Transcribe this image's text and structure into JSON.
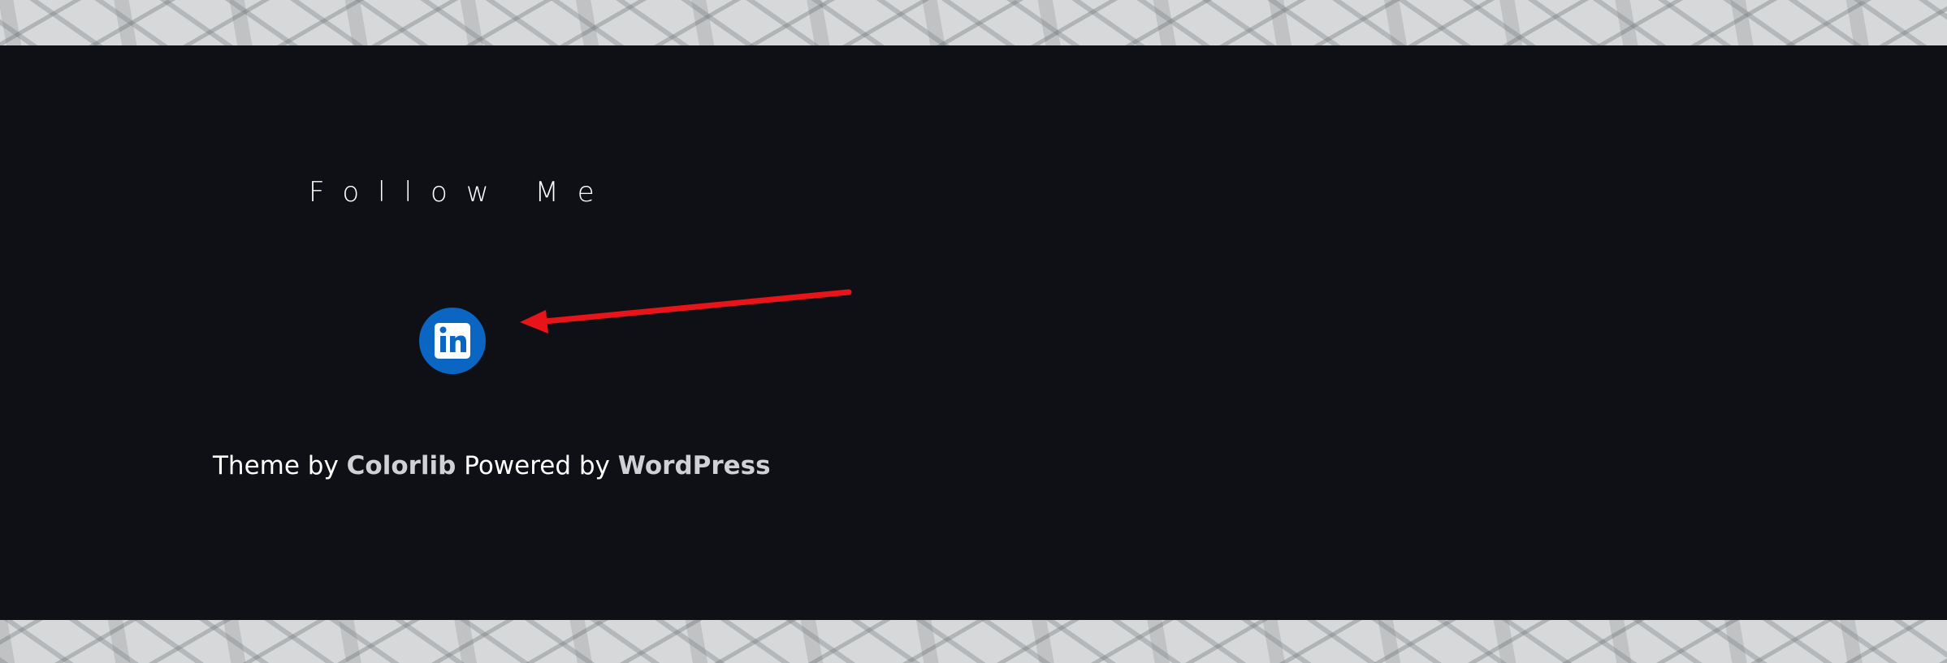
{
  "widget": {
    "title": "Follow Me"
  },
  "social": {
    "linkedin_icon": "linkedin-icon",
    "linkedin_color": "#0a66c2"
  },
  "annotation": {
    "arrow_color": "#e8141a"
  },
  "credits": {
    "theme_prefix": "Theme by ",
    "theme_author": "Colorlib",
    "powered_prefix": " Powered by ",
    "platform": "WordPress"
  },
  "colors": {
    "footer_background": "#0f1016",
    "link_color": "#cfd1d4"
  }
}
